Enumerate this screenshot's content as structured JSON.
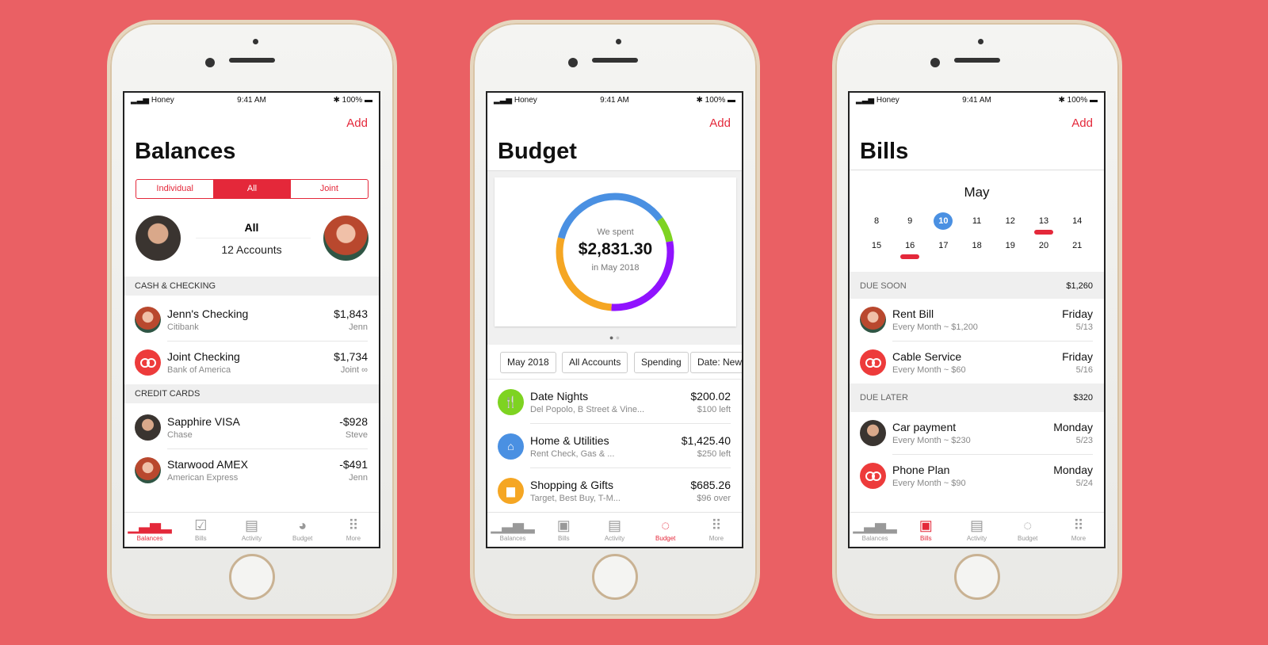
{
  "status": {
    "carrier": "Honey",
    "time": "9:41 AM",
    "battery": "100%"
  },
  "add_label": "Add",
  "tab_labels": [
    "Balances",
    "Bills",
    "Activity",
    "Budget",
    "More"
  ],
  "accent": "#E4283A",
  "balances": {
    "title": "Balances",
    "segments": [
      "Individual",
      "All",
      "Joint"
    ],
    "selected_segment": "All",
    "summary_title": "All",
    "summary_sub": "12 Accounts",
    "sections": [
      {
        "header": "CASH & CHECKING",
        "rows": [
          {
            "name": "Jenn's Checking",
            "sub": "Citibank",
            "amount": "$1,843",
            "owner": "Jenn",
            "avatar": "woman"
          },
          {
            "name": "Joint Checking",
            "sub": "Bank of America",
            "amount": "$1,734",
            "owner": "Joint ∞",
            "avatar": "joint"
          }
        ]
      },
      {
        "header": "CREDIT CARDS",
        "rows": [
          {
            "name": "Sapphire VISA",
            "sub": "Chase",
            "amount": "-$928",
            "owner": "Steve",
            "avatar": "man"
          },
          {
            "name": "Starwood AMEX",
            "sub": "American Express",
            "amount": "-$491",
            "owner": "Jenn",
            "avatar": "woman"
          }
        ]
      }
    ]
  },
  "budget": {
    "title": "Budget",
    "spent_label": "We spent",
    "spent_amount": "$2,831.30",
    "period": "in May 2018",
    "ring_segments": [
      {
        "color": "#4A90E2",
        "fraction": 0.15
      },
      {
        "color": "#7ED321",
        "fraction": 0.07
      },
      {
        "color": "#9013FE",
        "fraction": 0.29
      },
      {
        "color": "#F5A623",
        "fraction": 0.28
      },
      {
        "color": "#4A90E2",
        "fraction": 0.21
      }
    ],
    "filters": [
      "May 2018",
      "All Accounts",
      "Spending",
      "Date: New"
    ],
    "rows": [
      {
        "name": "Date Nights",
        "sub": "Del Popolo, B Street & Vine...",
        "amount": "$200.02",
        "status": "$100 left",
        "color": "#7ED321",
        "icon": "fork-knife"
      },
      {
        "name": "Home & Utilities",
        "sub": "Rent Check, Gas & ...",
        "amount": "$1,425.40",
        "status": "$250 left",
        "color": "#4A90E2",
        "icon": "house"
      },
      {
        "name": "Shopping & Gifts",
        "sub": "Target, Best Buy, T-M...",
        "amount": "$685.26",
        "status": "$96 over",
        "color": "#F5A623",
        "icon": "bag"
      }
    ]
  },
  "bills": {
    "title": "Bills",
    "month": "May",
    "week1": [
      "8",
      "9",
      "10",
      "11",
      "12",
      "13",
      "14"
    ],
    "week2": [
      "15",
      "16",
      "17",
      "18",
      "19",
      "20",
      "21"
    ],
    "today": "10",
    "sections": [
      {
        "header": "DUE SOON",
        "total": "$1,260",
        "rows": [
          {
            "name": "Rent Bill",
            "sub": "Every Month ~ $1,200",
            "day": "Friday",
            "date": "5/13",
            "avatar": "woman"
          },
          {
            "name": "Cable Service",
            "sub": "Every Month ~ $60",
            "day": "Friday",
            "date": "5/16",
            "avatar": "joint"
          }
        ]
      },
      {
        "header": "DUE LATER",
        "total": "$320",
        "rows": [
          {
            "name": "Car payment",
            "sub": "Every Month ~ $230",
            "day": "Monday",
            "date": "5/23",
            "avatar": "man"
          },
          {
            "name": "Phone Plan",
            "sub": "Every Month ~ $90",
            "day": "Monday",
            "date": "5/24",
            "avatar": "joint"
          }
        ]
      }
    ]
  }
}
